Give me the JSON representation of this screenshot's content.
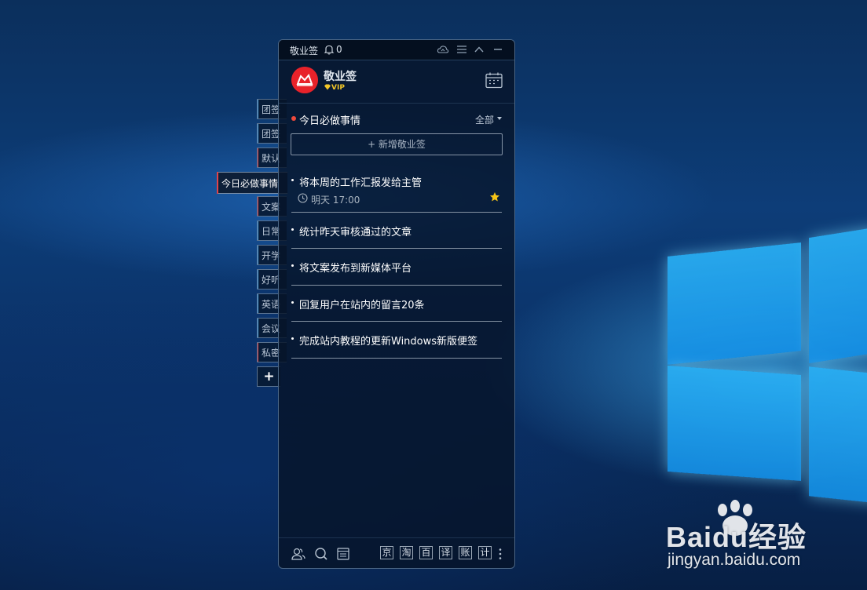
{
  "app": {
    "title": "敬业签",
    "notification_count": "0",
    "name": "敬业签",
    "vip": "VIP",
    "accent_color": "#e8222a"
  },
  "side_tabs": [
    {
      "label": "团签",
      "color": "#4aa3e8"
    },
    {
      "label": "团签",
      "color": "#4aa3e8"
    },
    {
      "label": "默认",
      "color": "#e0434a"
    },
    {
      "label": "文案",
      "color": "#e0434a"
    },
    {
      "label": "日常",
      "color": "#4aa3e8"
    },
    {
      "label": "开学",
      "color": "#4aa3e8"
    },
    {
      "label": "好听",
      "color": "#4aa3e8"
    },
    {
      "label": "英语",
      "color": "#4aa3e8"
    },
    {
      "label": "会议",
      "color": "#4aa3e8"
    },
    {
      "label": "私密",
      "color": "#e0434a"
    }
  ],
  "active_tab": {
    "label": "今日必做事情"
  },
  "add_tab": {
    "label": "+"
  },
  "section": {
    "title": "今日必做事情",
    "filter": "全部",
    "add_button": "+ 新增敬业签"
  },
  "tasks": [
    {
      "title": "将本周的工作汇报发给主管",
      "time": "明天 17:00",
      "starred": true
    },
    {
      "title": "统计昨天审核通过的文章"
    },
    {
      "title": "将文案发布到新媒体平台"
    },
    {
      "title": "回复用户在站内的留言20条"
    },
    {
      "title": "完成站内教程的更新Windows新版便签"
    }
  ],
  "bottom_chars": [
    "京",
    "淘",
    "百",
    "译",
    "账",
    "计"
  ],
  "watermark": {
    "brand": "Baidu经验",
    "url": "jingyan.baidu.com"
  }
}
